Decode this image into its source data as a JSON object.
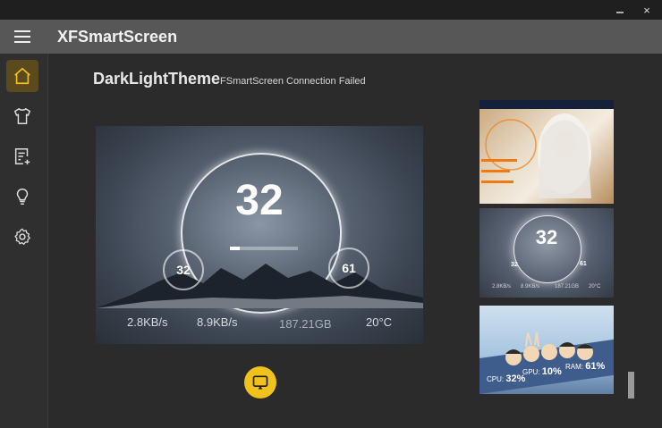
{
  "window": {
    "close_glyph": "×"
  },
  "app": {
    "title": "XFSmartScreen"
  },
  "sidebar": {
    "items": [
      {
        "name": "home",
        "icon": "home-icon",
        "active": true
      },
      {
        "name": "theme",
        "icon": "shirt-icon",
        "active": false
      },
      {
        "name": "editor",
        "icon": "edit-note-icon",
        "active": false
      },
      {
        "name": "ideas",
        "icon": "lightbulb-icon",
        "active": false
      },
      {
        "name": "settings",
        "icon": "gear-icon",
        "active": false
      }
    ],
    "accent": "#f1c21b"
  },
  "main": {
    "theme_name": "DarkLightTheme",
    "status": "FSmartScreen Connection Failed",
    "preview": {
      "big_value": "32",
      "progress": 0.15,
      "left_value": "32",
      "right_value": "61",
      "upload": "2.8KB/s",
      "download": "8.9KB/s",
      "storage": "187.21GB",
      "temperature": "20°C"
    },
    "cast_button_icon": "cast-icon"
  },
  "thumbnails": {
    "light": {
      "big_value": "32",
      "left_value": "32",
      "right_value": "61",
      "stat1": "2.8KB/s",
      "stat2": "8.9KB/s",
      "stat3": "187.21GB",
      "stat4": "20°C"
    },
    "cartoon": {
      "cpu_label": "CPU:",
      "cpu_value": "32%",
      "gpu_label": "GPU:",
      "gpu_value": "10%",
      "ram_label": "RAM:",
      "ram_value": "61%"
    }
  }
}
